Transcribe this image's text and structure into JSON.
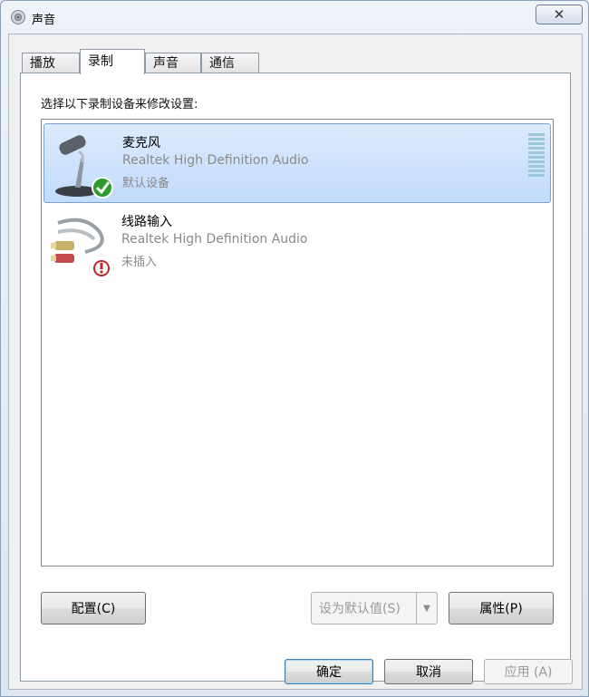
{
  "window": {
    "title": "声音",
    "close_symbol": "✕"
  },
  "tabs": [
    {
      "label": "播放",
      "active": false
    },
    {
      "label": "录制",
      "active": true
    },
    {
      "label": "声音",
      "active": false
    },
    {
      "label": "通信",
      "active": false
    }
  ],
  "panel": {
    "instruction": "选择以下录制设备来修改设置:"
  },
  "devices": [
    {
      "name": "麦克风",
      "driver": "Realtek High Definition Audio",
      "status": "默认设备",
      "selected": true,
      "icon": "microphone-icon",
      "badge_icon": "default-check-icon"
    },
    {
      "name": "线路输入",
      "driver": "Realtek High Definition Audio",
      "status": "未插入",
      "selected": false,
      "icon": "line-in-cable-icon",
      "badge_icon": "unplugged-icon"
    }
  ],
  "buttons": {
    "configure": "配置(C)",
    "set_default": "设为默认值(S)",
    "properties": "属性(P)",
    "ok": "确定",
    "cancel": "取消",
    "apply": "应用 (A)"
  },
  "colors": {
    "selection": "#c1dbfc",
    "selection_border": "#7da2ce",
    "default_check": "#2a9d2a",
    "unplugged": "#c0282c"
  }
}
